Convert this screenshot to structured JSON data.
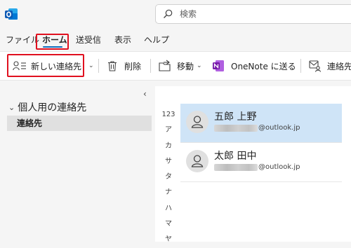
{
  "search": {
    "placeholder": "検索"
  },
  "menu": {
    "tabs": [
      {
        "label": "ファイル"
      },
      {
        "label": "ホーム",
        "active": true
      },
      {
        "label": "送受信"
      },
      {
        "label": "表示"
      },
      {
        "label": "ヘルプ"
      }
    ]
  },
  "ribbon": {
    "new_contact": "新しい連絡先",
    "delete": "削除",
    "move": "移動",
    "onenote": "OneNote に送る",
    "contact": "連絡先"
  },
  "sidebar": {
    "group_label": "個人用の連絡先",
    "items": [
      {
        "label": "連絡先"
      }
    ]
  },
  "index": [
    "123",
    "ア",
    "カ",
    "サ",
    "タ",
    "ナ",
    "ハ",
    "マ",
    "ヤ"
  ],
  "contacts": [
    {
      "name": "五郎 上野",
      "email_suffix": "@outlook.jp",
      "selected": true
    },
    {
      "name": "太郎 田中",
      "email_suffix": "@outlook.jp",
      "selected": false
    }
  ],
  "colors": {
    "accent": "#0f6cbd",
    "highlight_box": "#e0101f",
    "selected_row": "#cfe4f7",
    "onenote": "#7719aa"
  }
}
